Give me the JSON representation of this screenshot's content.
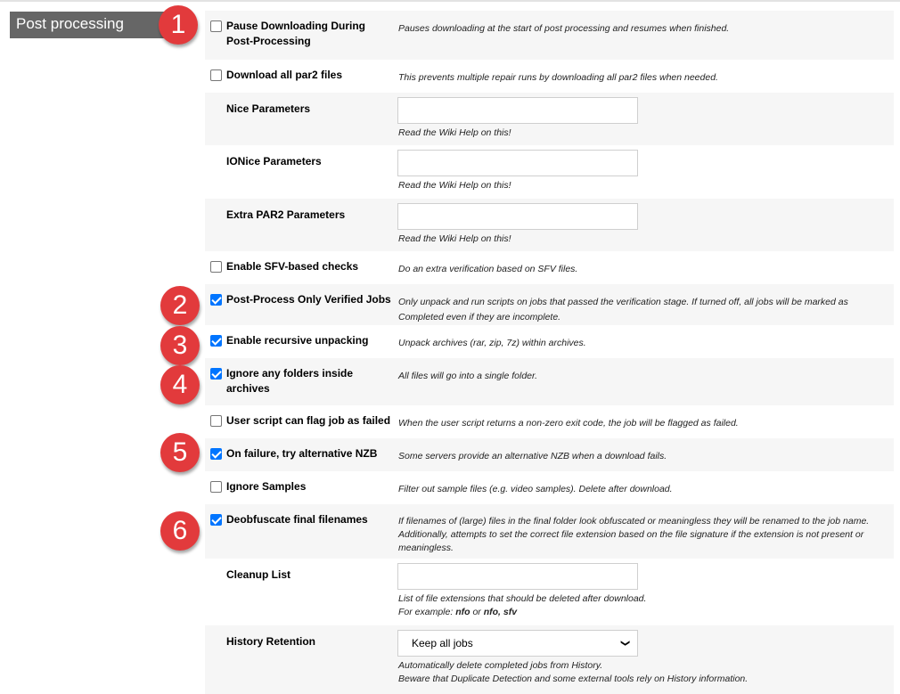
{
  "section": {
    "title": "Post processing"
  },
  "badges": [
    "1",
    "2",
    "3",
    "4",
    "5",
    "6"
  ],
  "settings": [
    {
      "type": "checkbox",
      "label": "Pause Downloading During Post-Processing",
      "checked": false,
      "description": "Pauses downloading at the start of post processing and resumes when finished."
    },
    {
      "type": "checkbox",
      "label": "Download all par2 files",
      "checked": false,
      "description": "This prevents multiple repair runs by downloading all par2 files when needed."
    },
    {
      "type": "text",
      "label": "Nice Parameters",
      "value": "",
      "help": "Read the Wiki Help on this!"
    },
    {
      "type": "text",
      "label": "IONice Parameters",
      "value": "",
      "help": "Read the Wiki Help on this!"
    },
    {
      "type": "text",
      "label": "Extra PAR2 Parameters",
      "value": "",
      "help": "Read the Wiki Help on this!"
    },
    {
      "type": "checkbox",
      "label": "Enable SFV-based checks",
      "checked": false,
      "description": "Do an extra verification based on SFV files."
    },
    {
      "type": "checkbox",
      "label": "Post-Process Only Verified Jobs",
      "checked": true,
      "description": "Only unpack and run scripts on jobs that passed the verification stage. If turned off, all jobs will be marked as Completed even if they are incomplete."
    },
    {
      "type": "checkbox",
      "label": "Enable recursive unpacking",
      "checked": true,
      "description": "Unpack archives (rar, zip, 7z) within archives."
    },
    {
      "type": "checkbox",
      "label": "Ignore any folders inside archives",
      "checked": true,
      "description": "All files will go into a single folder."
    },
    {
      "type": "checkbox",
      "label": "User script can flag job as failed",
      "checked": false,
      "description": "When the user script returns a non-zero exit code, the job will be flagged as failed."
    },
    {
      "type": "checkbox",
      "label": "On failure, try alternative NZB",
      "checked": true,
      "description": "Some servers provide an alternative NZB when a download fails."
    },
    {
      "type": "checkbox",
      "label": "Ignore Samples",
      "checked": false,
      "description": "Filter out sample files (e.g. video samples). Delete after download."
    },
    {
      "type": "checkbox",
      "label": "Deobfuscate final filenames",
      "checked": true,
      "description": "If filenames of (large) files in the final folder look obfuscated or meaningless they will be renamed to the job name. Additionally, attempts to set the correct file extension based on the file signature if the extension is not present or meaningless."
    },
    {
      "type": "text",
      "label": "Cleanup List",
      "value": "",
      "help": "List of file extensions that should be deleted after download.",
      "help_example_prefix": "For example: ",
      "help_example_1": "nfo",
      "help_example_or": " or ",
      "help_example_2": "nfo, sfv"
    },
    {
      "type": "select",
      "label": "History Retention",
      "value": "Keep all jobs",
      "help": "Automatically delete completed jobs from History.",
      "help_2": "Beware that Duplicate Detection and some external tools rely on History information."
    }
  ],
  "colors": {
    "badge": "#e23a3c",
    "header_bg": "#666666",
    "row_grey": "#f6f6f6",
    "checkbox_checked": "#0075ff"
  }
}
